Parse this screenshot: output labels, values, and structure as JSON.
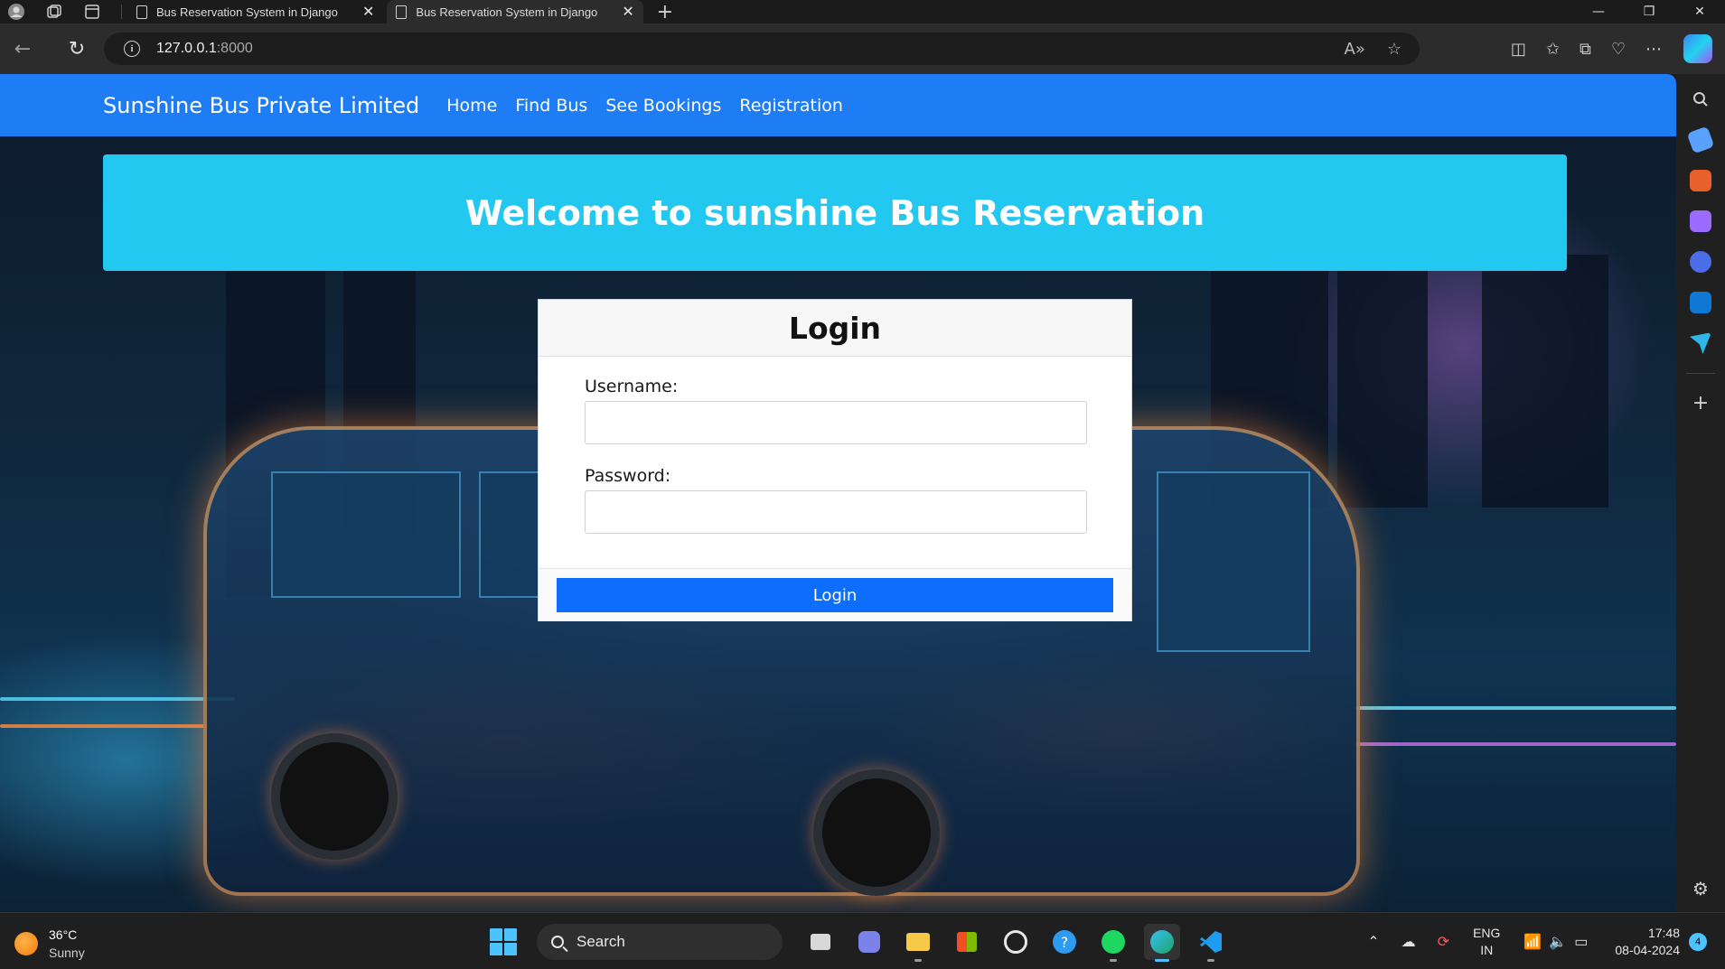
{
  "browser": {
    "tabs": [
      {
        "title": "Bus Reservation System in Django"
      },
      {
        "title": "Bus Reservation System in Django"
      }
    ],
    "new_tab_label": "+",
    "address": {
      "host": "127.0.0.1",
      "port": ":8000"
    }
  },
  "navbar": {
    "brand": "Sunshine Bus Private Limited",
    "links": [
      {
        "label": "Home"
      },
      {
        "label": "Find Bus"
      },
      {
        "label": "See Bookings"
      },
      {
        "label": "Registration"
      }
    ],
    "color": "#1e7cf5"
  },
  "banner": {
    "title": "Welcome to sunshine Bus Reservation",
    "color": "#22c8ef"
  },
  "login": {
    "title": "Login",
    "username_label": "Username:",
    "username_value": "",
    "password_label": "Password:",
    "password_value": "",
    "submit_label": "Login",
    "button_color": "#0d6efd"
  },
  "taskbar": {
    "weather": {
      "temp": "36°C",
      "condition": "Sunny"
    },
    "search_label": "Search",
    "language": {
      "code": "ENG",
      "region": "IN"
    },
    "time": "17:48",
    "date": "08-04-2024",
    "notification_count": "4"
  }
}
